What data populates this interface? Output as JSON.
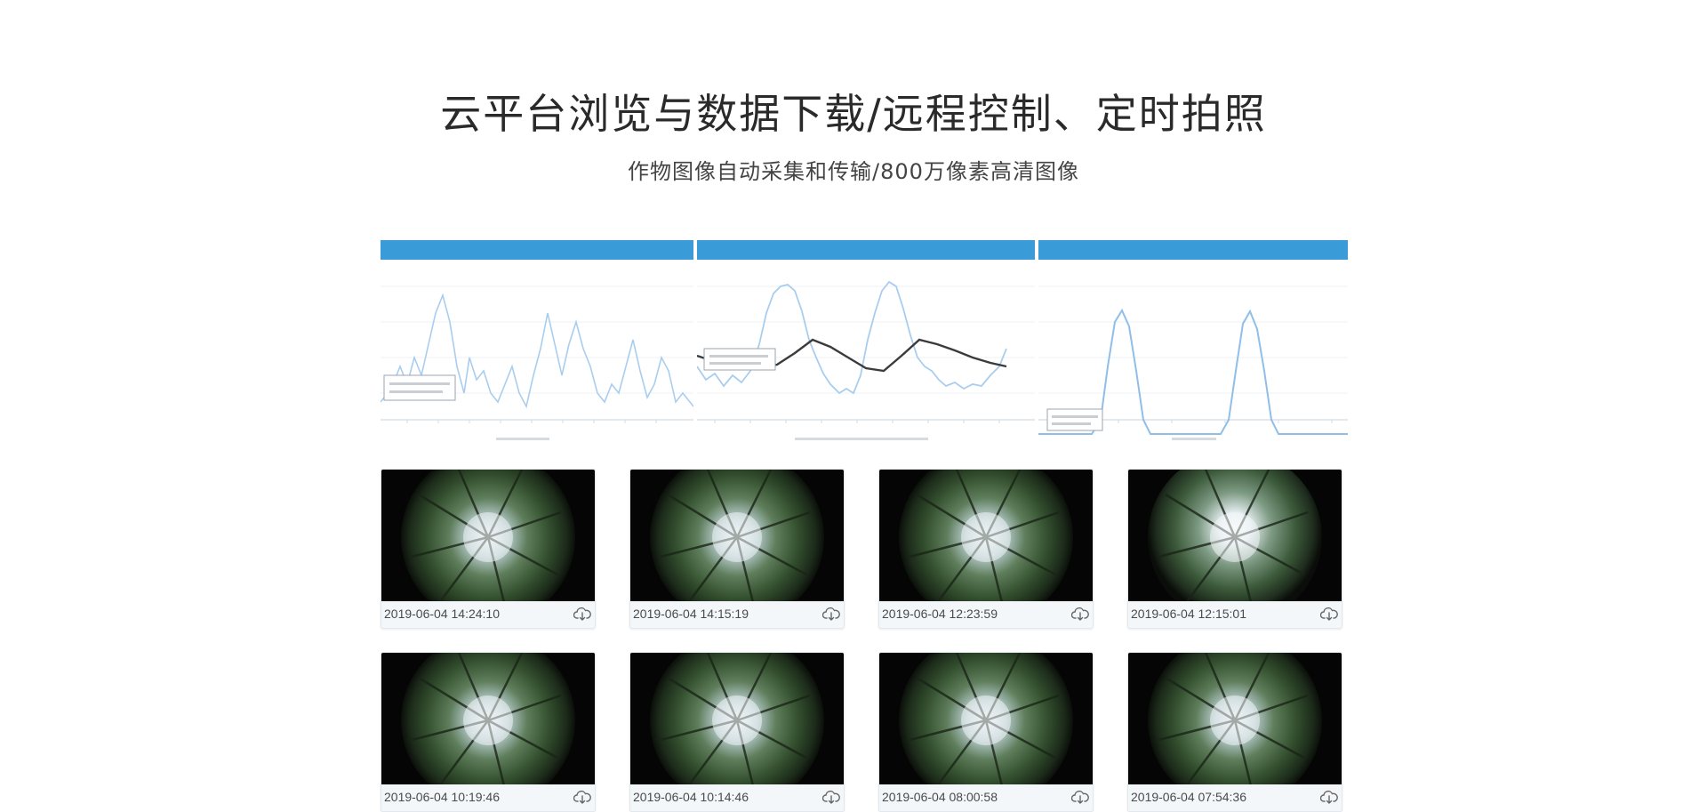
{
  "header": {
    "title": "云平台浏览与数据下载/远程控制、定时拍照",
    "subtitle": "作物图像自动采集和传输/800万像素高清图像"
  },
  "colors": {
    "chart_header": "#3a9bd9",
    "chart_line": "#a9cdee",
    "trend_line": "#3b3b3b",
    "card_bg": "#f4f7fa"
  },
  "photos": [
    {
      "timestamp": "2019-06-04 14:24:10",
      "download_icon": "cloud-download-icon"
    },
    {
      "timestamp": "2019-06-04 14:15:19",
      "download_icon": "cloud-download-icon"
    },
    {
      "timestamp": "2019-06-04 12:23:59",
      "download_icon": "cloud-download-icon"
    },
    {
      "timestamp": "2019-06-04 12:15:01",
      "download_icon": "cloud-download-icon"
    },
    {
      "timestamp": "2019-06-04 10:19:46",
      "download_icon": "cloud-download-icon"
    },
    {
      "timestamp": "2019-06-04 10:14:46",
      "download_icon": "cloud-download-icon"
    },
    {
      "timestamp": "2019-06-04 08:00:58",
      "download_icon": "cloud-download-icon"
    },
    {
      "timestamp": "2019-06-04 07:54:36",
      "download_icon": "cloud-download-icon"
    }
  ]
}
